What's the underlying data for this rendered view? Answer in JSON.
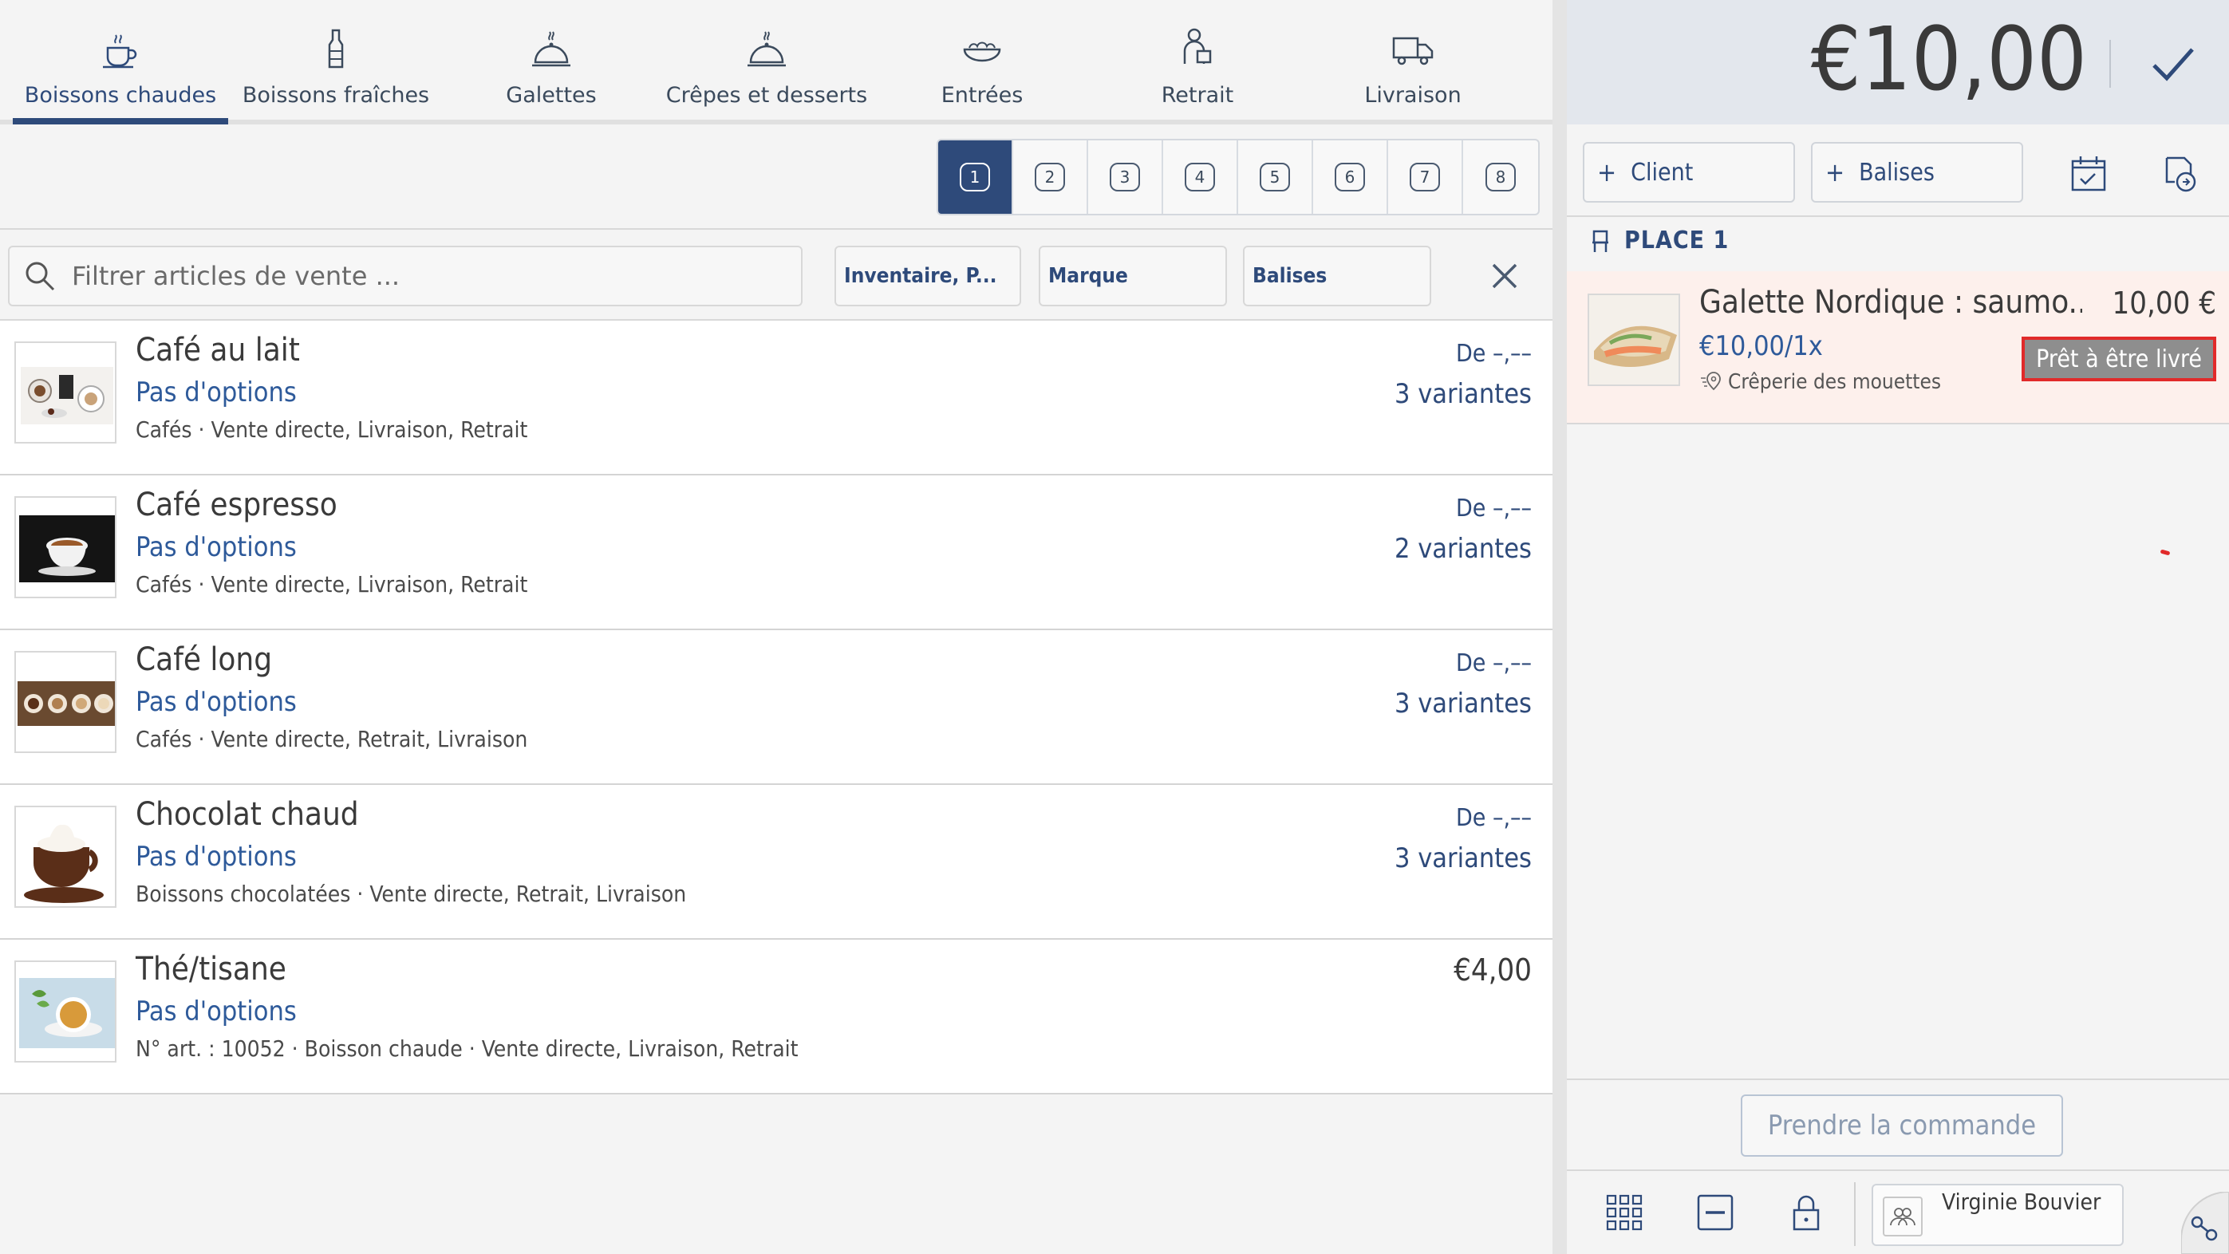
{
  "tabs": [
    {
      "label": "Boissons chaudes",
      "icon": "hot-drink-icon",
      "active": true
    },
    {
      "label": "Boissons fraîches",
      "icon": "bottle-icon"
    },
    {
      "label": "Galettes",
      "icon": "cloche-icon"
    },
    {
      "label": "Crêpes et desserts",
      "icon": "cloche-icon"
    },
    {
      "label": "Entrées",
      "icon": "salad-bowl-icon"
    },
    {
      "label": "Retrait",
      "icon": "pickup-icon"
    },
    {
      "label": "Livraison",
      "icon": "delivery-truck-icon"
    }
  ],
  "pages": [
    "1",
    "2",
    "3",
    "4",
    "5",
    "6",
    "7",
    "8"
  ],
  "active_page": "1",
  "search": {
    "placeholder": "Filtrer articles de vente ..."
  },
  "filters": {
    "inventory": "Inventaire, P...",
    "brand": "Marque",
    "tags": "Balises"
  },
  "items": [
    {
      "name": "Café au lait",
      "options": "Pas d'options",
      "meta": "Cafés · Vente directe, Livraison, Retrait",
      "price": "De –,––",
      "variants": "3 variantes"
    },
    {
      "name": "Café espresso",
      "options": "Pas d'options",
      "meta": "Cafés · Vente directe, Livraison, Retrait",
      "price": "De –,––",
      "variants": "2 variantes"
    },
    {
      "name": "Café long",
      "options": "Pas d'options",
      "meta": "Cafés · Vente directe, Retrait, Livraison",
      "price": "De –,––",
      "variants": "3 variantes"
    },
    {
      "name": "Chocolat chaud",
      "options": "Pas d'options",
      "meta": "Boissons chocolatées · Vente directe, Retrait, Livraison",
      "price": "De –,––",
      "variants": "3 variantes"
    },
    {
      "name": "Thé/tisane",
      "options": "Pas d'options",
      "meta": "N° art. : 10052 · Boisson chaude · Vente directe, Livraison, Retrait",
      "price": "€4,00",
      "variants": ""
    }
  ],
  "order": {
    "total": "€10,00",
    "client_label": "Client",
    "tags_label": "Balises",
    "place": "PLACE 1",
    "line": {
      "name": "Galette Nordique : saumo...",
      "price": "10,00 €",
      "unit": "€10,00/1x",
      "shop": "Crêperie des mouettes",
      "status": "Prêt à être livré"
    },
    "take_order": "Prendre la commande",
    "user": "Virginie Bouvier"
  },
  "colors": {
    "accent": "#2e4a7a",
    "status_border": "#e12a2a",
    "line_bg": "#fdf0ec"
  }
}
